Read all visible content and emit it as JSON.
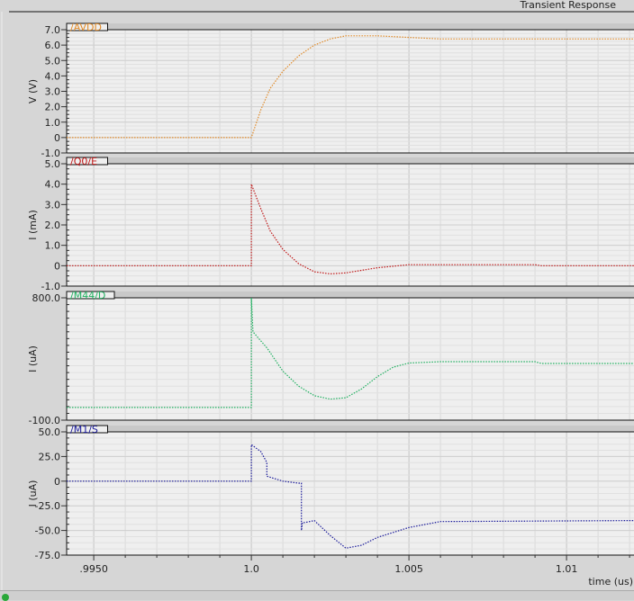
{
  "window": {
    "title": "Transient Response"
  },
  "colors": {
    "background": "#d6d6d6",
    "plot_bg": "#efefef",
    "grid": "#d2d2d2"
  },
  "chart_data": [
    {
      "type": "line",
      "signal": "/AVDD",
      "color": "#e08a28",
      "ylabel": "V (V)",
      "ylim": [
        -1.0,
        7.0
      ],
      "yticks": [
        -1.0,
        0,
        1.0,
        2.0,
        3.0,
        4.0,
        5.0,
        6.0,
        7.0
      ],
      "ytick_labels": [
        "-1.0",
        "0",
        "1.0",
        "2.0",
        "3.0",
        "4.0",
        "5.0",
        "6.0",
        "7.0"
      ],
      "grid": true,
      "x": [
        0.99414,
        1.0,
        1.0003,
        1.0006,
        1.001,
        1.0015,
        1.002,
        1.0025,
        1.003,
        1.004,
        1.005,
        1.006,
        1.01214
      ],
      "y": [
        0,
        0,
        1.8,
        3.2,
        4.3,
        5.3,
        6.0,
        6.4,
        6.6,
        6.6,
        6.5,
        6.4,
        6.4
      ]
    },
    {
      "type": "line",
      "signal": "/Q0/E",
      "color": "#c01818",
      "ylabel": "I (mA)",
      "ylim": [
        -1.0,
        5.0
      ],
      "yticks": [
        -1.0,
        0,
        1.0,
        2.0,
        3.0,
        4.0,
        5.0
      ],
      "ytick_labels": [
        "-1.0",
        "0",
        "1.0",
        "2.0",
        "3.0",
        "4.0",
        "5.0"
      ],
      "grid": true,
      "x": [
        0.99414,
        1.0,
        1.0,
        1.0003,
        1.0006,
        1.001,
        1.0015,
        1.002,
        1.0025,
        1.003,
        1.004,
        1.005,
        1.009,
        1.0092,
        1.01214
      ],
      "y": [
        0,
        0,
        4.0,
        2.8,
        1.7,
        0.8,
        0.1,
        -0.3,
        -0.4,
        -0.35,
        -0.1,
        0.05,
        0.05,
        0,
        0
      ]
    },
    {
      "type": "line",
      "signal": "/M44/D",
      "color": "#20b060",
      "ylabel": "I (uA)",
      "ylim": [
        -100.0,
        800.0
      ],
      "yticks": [
        -100.0,
        800.0
      ],
      "ytick_labels": [
        "-100.0",
        "800.0"
      ],
      "grid": true,
      "x": [
        0.99414,
        1.0,
        1.0,
        1.00005,
        1.0005,
        1.001,
        1.0015,
        1.002,
        1.0025,
        1.003,
        1.0035,
        1.004,
        1.0045,
        1.005,
        1.006,
        1.009,
        1.0092,
        1.01214
      ],
      "y": [
        -7,
        -7,
        800,
        550,
        430,
        260,
        150,
        80,
        55,
        65,
        130,
        220,
        290,
        320,
        330,
        330,
        317,
        317
      ]
    },
    {
      "type": "line",
      "signal": "/M1/S",
      "color": "#1a1a9a",
      "ylabel": "I (uA)",
      "ylim": [
        -75.0,
        50.0
      ],
      "yticks": [
        -75.0,
        -50.0,
        -25.0,
        0,
        25.0,
        50.0
      ],
      "ytick_labels": [
        "-75.0",
        "-50.0",
        "-25.0",
        "0",
        "25.0",
        "50.0"
      ],
      "grid": true,
      "x": [
        0.99414,
        1.0,
        1.0,
        1.0003,
        1.00049,
        1.00049,
        1.001,
        1.0015,
        1.00159,
        1.00159,
        1.00162,
        1.0017,
        1.002,
        1.0025,
        1.003,
        1.0035,
        1.004,
        1.005,
        1.006,
        1.01214
      ],
      "y": [
        0,
        0,
        37,
        30,
        19,
        5,
        0,
        -2,
        -2,
        -50,
        -42,
        -42,
        -40,
        -55,
        -68,
        -65,
        -57,
        -47,
        -41,
        -40
      ]
    }
  ],
  "x_axis": {
    "label": "time (us)",
    "xlim": [
      0.99414,
      1.01214
    ],
    "ticks": [
      0.995,
      1.0,
      1.005,
      1.01
    ],
    "tick_labels": [
      ".9950",
      "1.0",
      "1.005",
      "1.01"
    ]
  }
}
